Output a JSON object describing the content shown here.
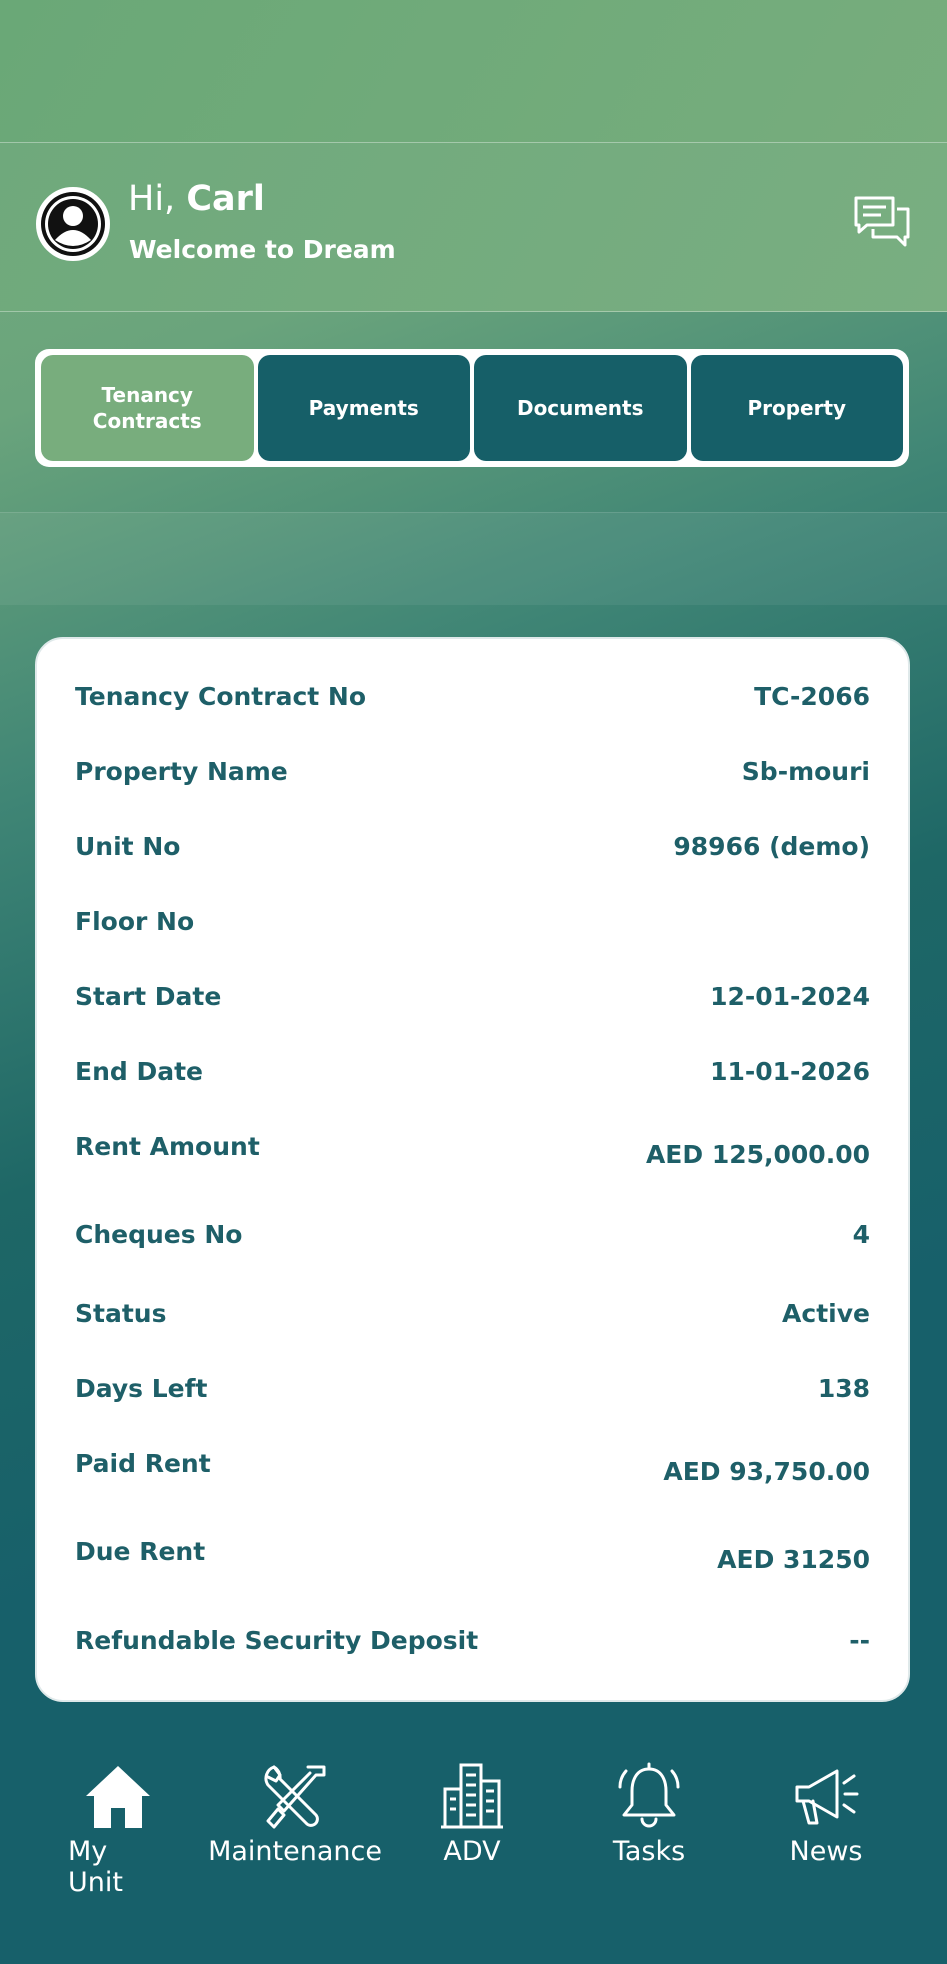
{
  "header": {
    "greeting": "Hi,",
    "user_name": "Carl",
    "welcome": "Welcome to Dream"
  },
  "tabs": [
    {
      "label": "Tenancy\nContracts",
      "active": true
    },
    {
      "label": "Payments",
      "active": false
    },
    {
      "label": "Documents",
      "active": false
    },
    {
      "label": "Property",
      "active": false
    }
  ],
  "contract": {
    "rows": [
      {
        "label": "Tenancy Contract No",
        "value": "TC-2066"
      },
      {
        "label": "Property Name",
        "value": "Sb-mouri"
      },
      {
        "label": "Unit No",
        "value": "98966 (demo)"
      },
      {
        "label": "Floor No",
        "value": ""
      },
      {
        "label": "Start Date",
        "value": "12-01-2024"
      },
      {
        "label": "End Date",
        "value": "11-01-2026"
      },
      {
        "label": "Rent Amount",
        "value": "AED 125,000.00"
      },
      {
        "label": "Cheques No",
        "value": "4"
      },
      {
        "label": "Status",
        "value": "Active"
      },
      {
        "label": "Days Left",
        "value": "138"
      },
      {
        "label": "Paid Rent",
        "value": "AED 93,750.00"
      },
      {
        "label": "Due Rent",
        "value": "AED 31250"
      },
      {
        "label": "Refundable Security Deposit",
        "value": "--"
      }
    ]
  },
  "nav": [
    {
      "label": "My Unit",
      "icon": "home-icon"
    },
    {
      "label": "Maintenance",
      "icon": "tools-icon"
    },
    {
      "label": "ADV",
      "icon": "buildings-icon"
    },
    {
      "label": "Tasks",
      "icon": "bell-icon"
    },
    {
      "label": "News",
      "icon": "megaphone-icon"
    }
  ],
  "colors": {
    "accent_green": "#78ad7d",
    "teal": "#165f68",
    "text_teal": "#1e5f68"
  }
}
